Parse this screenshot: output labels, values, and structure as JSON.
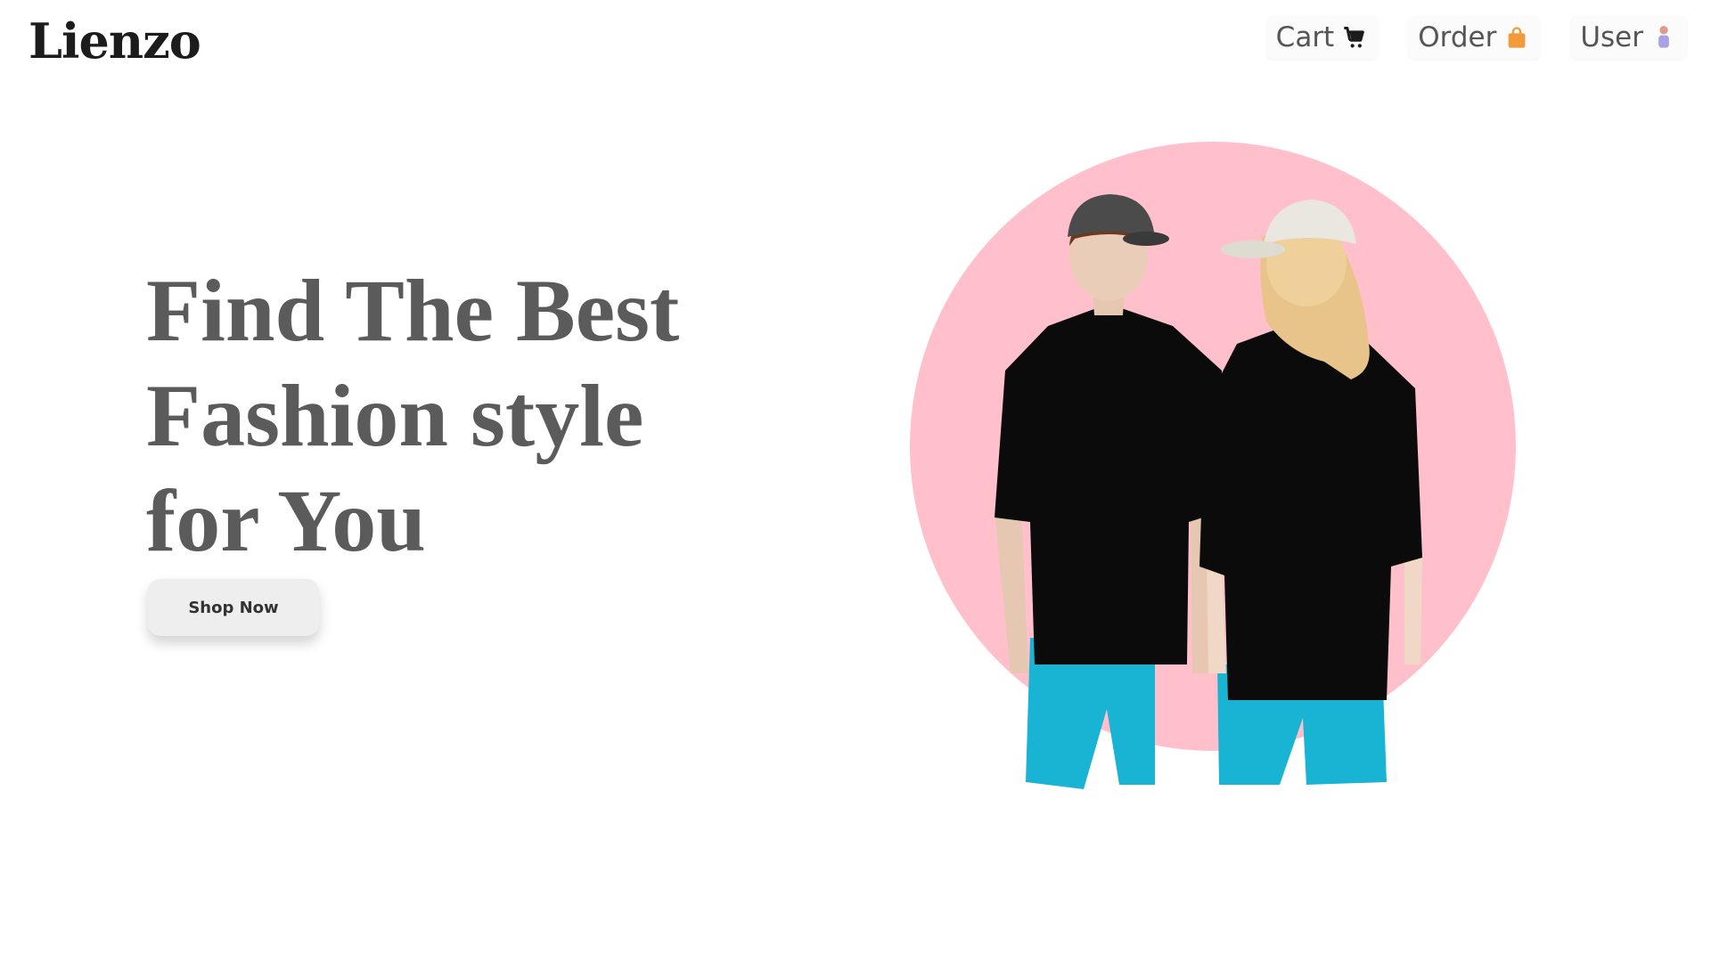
{
  "brand": {
    "name": "Lienzo"
  },
  "nav": {
    "items": [
      {
        "label": "Cart",
        "icon": "cart-icon"
      },
      {
        "label": "Order",
        "icon": "bag-icon"
      },
      {
        "label": "User",
        "icon": "user-icon"
      }
    ]
  },
  "hero": {
    "title_lines": [
      "Find The Best",
      "Fashion style",
      "for You"
    ],
    "cta_label": "Shop Now",
    "image": {
      "name": "models-photo"
    }
  },
  "colors": {
    "circle": "#ffc0cb",
    "shirt": "#0b0b0b",
    "shorts": "#19b4d4",
    "order_icon": "#f39a3b",
    "user_icon": "#a9a1e6"
  }
}
